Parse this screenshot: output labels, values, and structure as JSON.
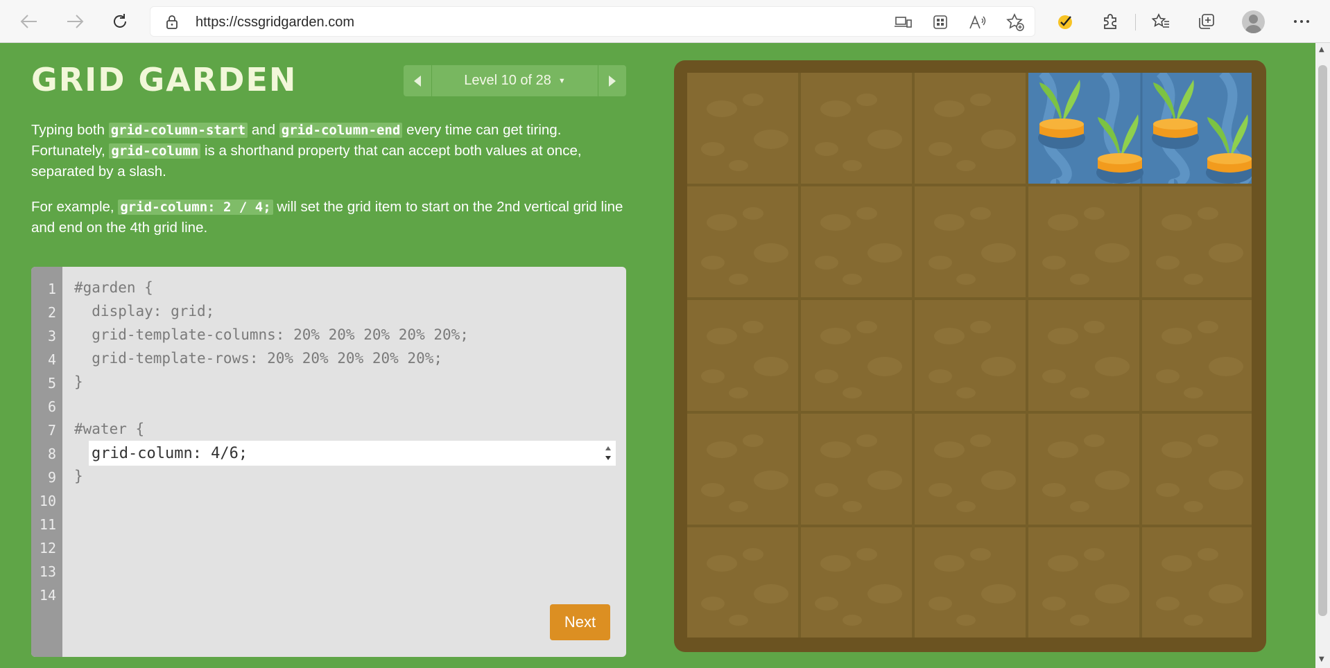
{
  "browser": {
    "url": "https://cssgridgarden.com"
  },
  "page": {
    "title": "GRID GARDEN",
    "level_label": "Level 10 of 28"
  },
  "instructions": {
    "p1_a": "Typing both ",
    "p1_code1": "grid-column-start",
    "p1_b": " and ",
    "p1_code2": "grid-column-end",
    "p1_c": " every time can get tiring. Fortunately, ",
    "p1_code3": "grid-column",
    "p1_d": " is a shorthand property that can accept both values at once, separated by a slash.",
    "p2_a": "For example, ",
    "p2_code": "grid-column: 2 / 4;",
    "p2_b": " will set the grid item to start on the 2nd vertical grid line and end on the 4th grid line."
  },
  "editor": {
    "line_numbers": [
      "1",
      "2",
      "3",
      "4",
      "5",
      "6",
      "7",
      "8",
      "9",
      "10",
      "11",
      "12",
      "13",
      "14"
    ],
    "lines": {
      "l1": "#garden {",
      "l2": "  display: grid;",
      "l3": "  grid-template-columns: 20% 20% 20% 20% 20%;",
      "l4": "  grid-template-rows: 20% 20% 20% 20% 20%;",
      "l5": "}",
      "l7": "#water {",
      "l9": "}"
    },
    "input_value": "grid-column: 4/6;",
    "next_label": "Next"
  },
  "colors": {
    "page_bg": "#5fa547",
    "soil": "#856a31",
    "water": "#4a7fb0",
    "next_button": "#dc8f22"
  }
}
